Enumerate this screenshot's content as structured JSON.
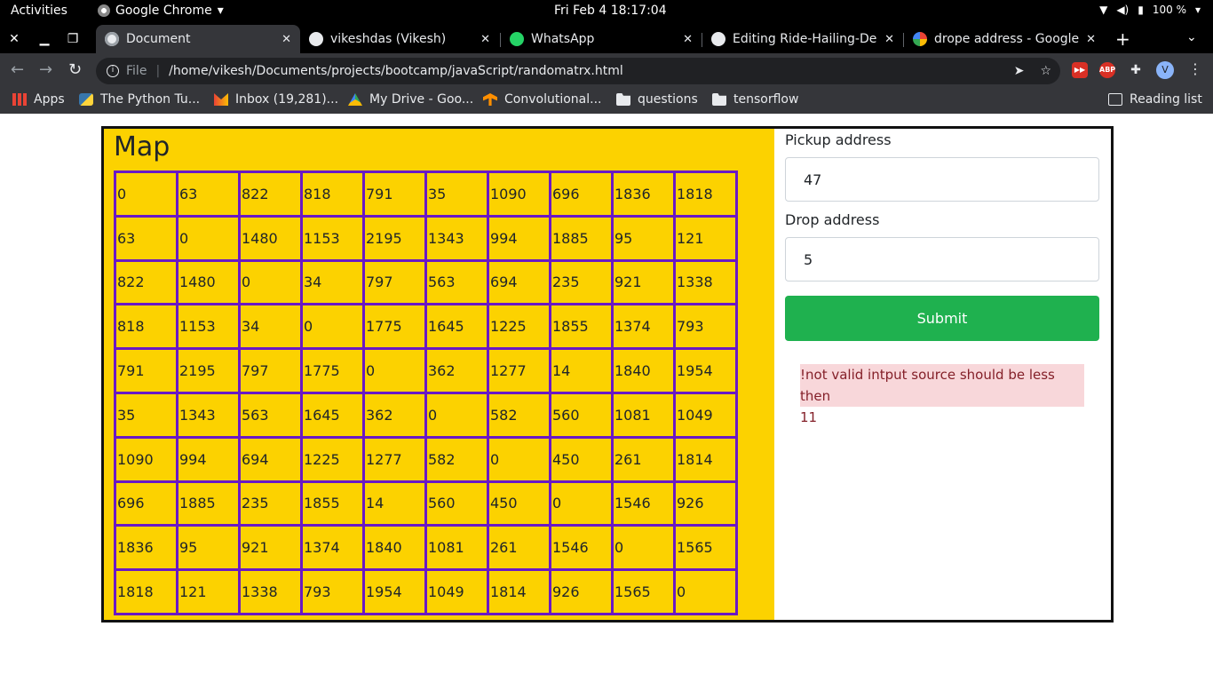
{
  "system": {
    "activities": "Activities",
    "app_name": "Google Chrome",
    "clock": "Fri Feb 4  18:17:04",
    "battery": "100 %"
  },
  "tabs": [
    {
      "title": "Document",
      "icon": "globe-icon",
      "active": true
    },
    {
      "title": "vikeshdas (Vikesh)",
      "icon": "github-icon",
      "active": false
    },
    {
      "title": "WhatsApp",
      "icon": "whatsapp-icon",
      "active": false
    },
    {
      "title": "Editing Ride-Hailing-Der",
      "icon": "github-icon",
      "active": false
    },
    {
      "title": "drope address - Google",
      "icon": "google-icon",
      "active": false
    }
  ],
  "address_bar": {
    "scheme_label": "File",
    "url": "/home/vikesh/Documents/projects/bootcamp/javaScript/randomatrx.html"
  },
  "bookmarks": {
    "items": [
      "Apps",
      "The Python Tu...",
      "Inbox (19,281)...",
      "My Drive - Goo...",
      "Convolutional...",
      "questions",
      "tensorflow"
    ],
    "reading_list": "Reading list"
  },
  "map": {
    "title": "Map",
    "matrix": [
      [
        "0",
        "63",
        "822",
        "818",
        "791",
        "35",
        "1090",
        "696",
        "1836",
        "1818"
      ],
      [
        "63",
        "0",
        "1480",
        "1153",
        "2195",
        "1343",
        "994",
        "1885",
        "95",
        "121"
      ],
      [
        "822",
        "1480",
        "0",
        "34",
        "797",
        "563",
        "694",
        "235",
        "921",
        "1338"
      ],
      [
        "818",
        "1153",
        "34",
        "0",
        "1775",
        "1645",
        "1225",
        "1855",
        "1374",
        "793"
      ],
      [
        "791",
        "2195",
        "797",
        "1775",
        "0",
        "362",
        "1277",
        "14",
        "1840",
        "1954"
      ],
      [
        "35",
        "1343",
        "563",
        "1645",
        "362",
        "0",
        "582",
        "560",
        "1081",
        "1049"
      ],
      [
        "1090",
        "994",
        "694",
        "1225",
        "1277",
        "582",
        "0",
        "450",
        "261",
        "1814"
      ],
      [
        "696",
        "1885",
        "235",
        "1855",
        "14",
        "560",
        "450",
        "0",
        "1546",
        "926"
      ],
      [
        "1836",
        "95",
        "921",
        "1374",
        "1840",
        "1081",
        "261",
        "1546",
        "0",
        "1565"
      ],
      [
        "1818",
        "121",
        "1338",
        "793",
        "1954",
        "1049",
        "1814",
        "926",
        "1565",
        "0"
      ]
    ]
  },
  "form": {
    "pickup_label": "Pickup address",
    "pickup_value": "47",
    "drop_label": "Drop address",
    "drop_value": "5",
    "submit_label": "Submit",
    "error_line1": "!not valid intput source should be less then",
    "error_line2": "11"
  },
  "colors": {
    "map_background": "#fcd200",
    "matrix_border": "#6a19c4",
    "submit_button": "#1fb14f",
    "alert_background": "#f8d7da",
    "alert_text": "#842029"
  }
}
